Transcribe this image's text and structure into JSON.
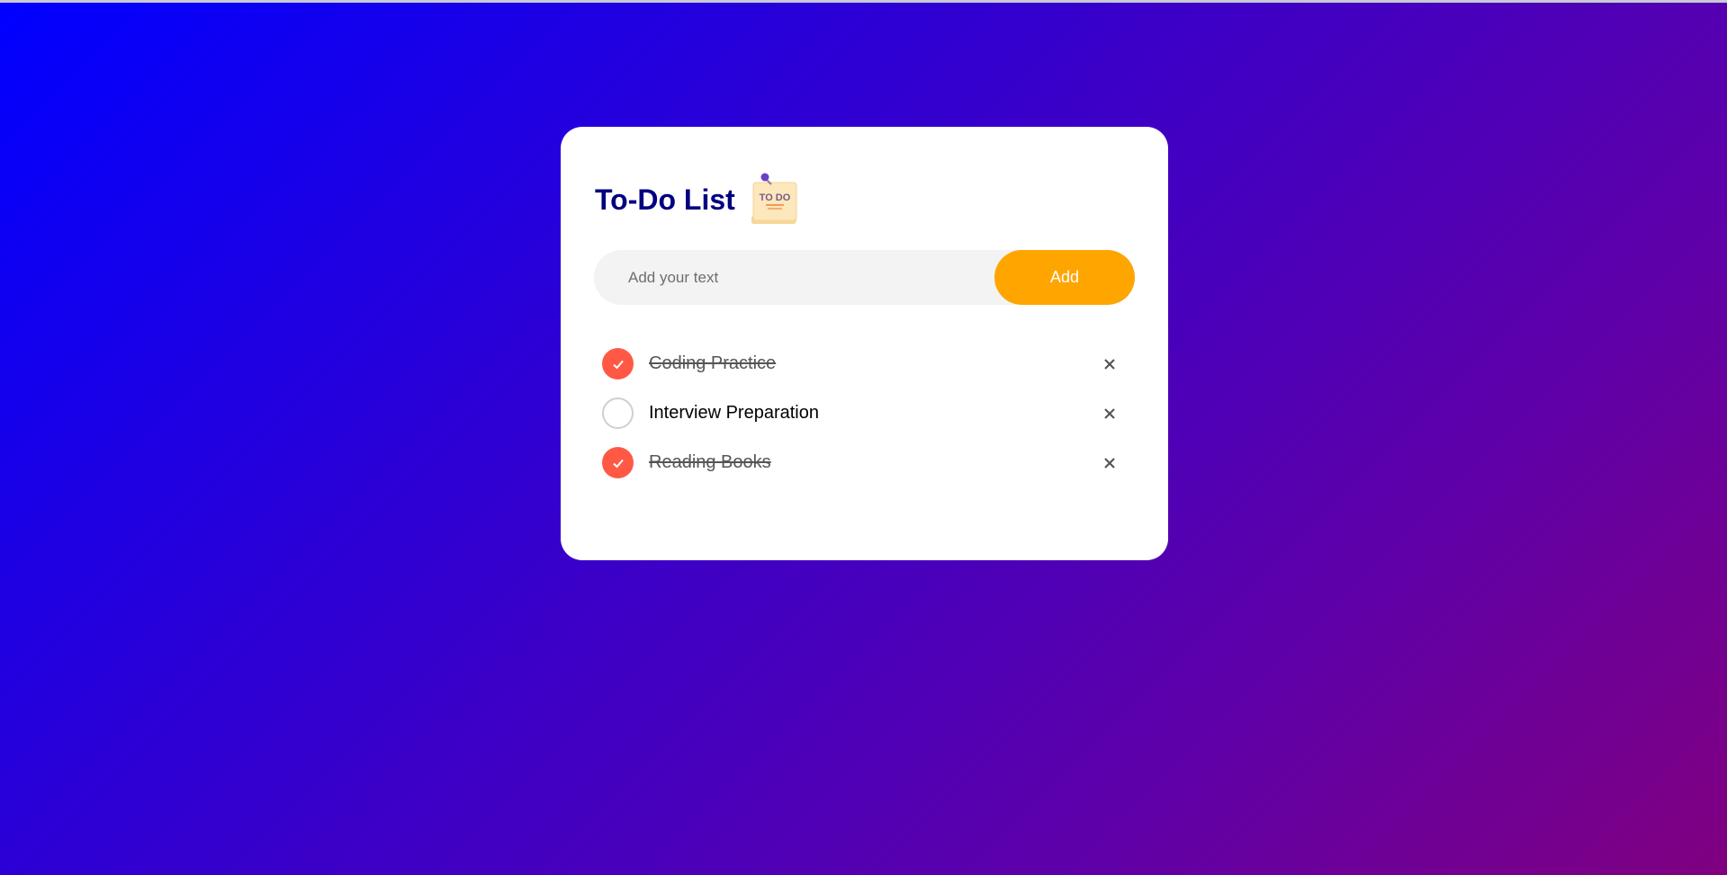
{
  "app": {
    "title": "To-Do List",
    "logo_text": "TO DO"
  },
  "input": {
    "placeholder": "Add your text",
    "value": "",
    "button_label": "Add"
  },
  "tasks": [
    {
      "text": "Coding Practice",
      "completed": true
    },
    {
      "text": "Interview Preparation",
      "completed": false
    },
    {
      "text": "Reading Books",
      "completed": true
    }
  ],
  "colors": {
    "title": "#000080",
    "accent": "#ffa500",
    "checked": "#ff5945",
    "background_start": "#0000ff",
    "background_end": "#800080"
  },
  "icons": {
    "logo": "todo-note-icon",
    "check": "checkmark-icon",
    "remove": "close-icon"
  }
}
